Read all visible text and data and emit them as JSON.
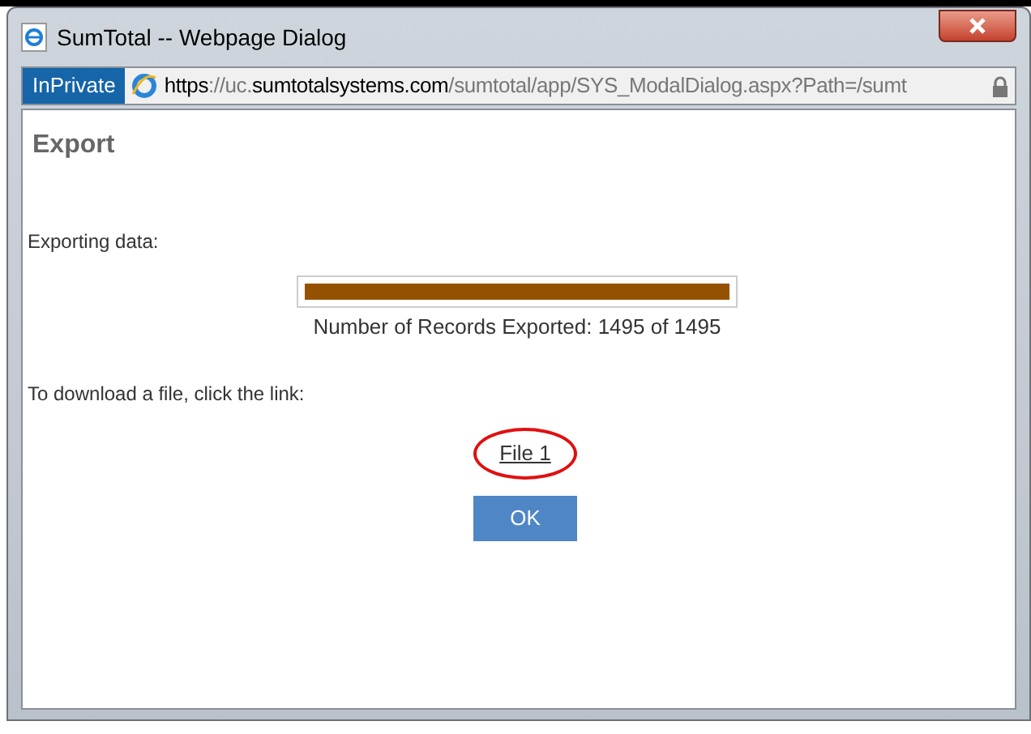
{
  "window": {
    "title": "SumTotal -- Webpage Dialog"
  },
  "address_bar": {
    "badge": "InPrivate",
    "url_parts": [
      {
        "text": "https",
        "emphasis": true
      },
      {
        "text": "://uc.",
        "emphasis": false
      },
      {
        "text": "sumtotalsystems.com",
        "emphasis": true
      },
      {
        "text": "/sumtotal/app/SYS_ModalDialog.aspx?Path=/sumt",
        "emphasis": false
      }
    ]
  },
  "dialog": {
    "heading": "Export",
    "status_label": "Exporting data:",
    "progress": {
      "level": 1,
      "reading": "Number of Records Exported: 1495 of 1495"
    },
    "download_label": "To download a file, click the link:",
    "files": [
      {
        "label": "File 1",
        "circled": true
      }
    ],
    "ok_button": "OK"
  }
}
